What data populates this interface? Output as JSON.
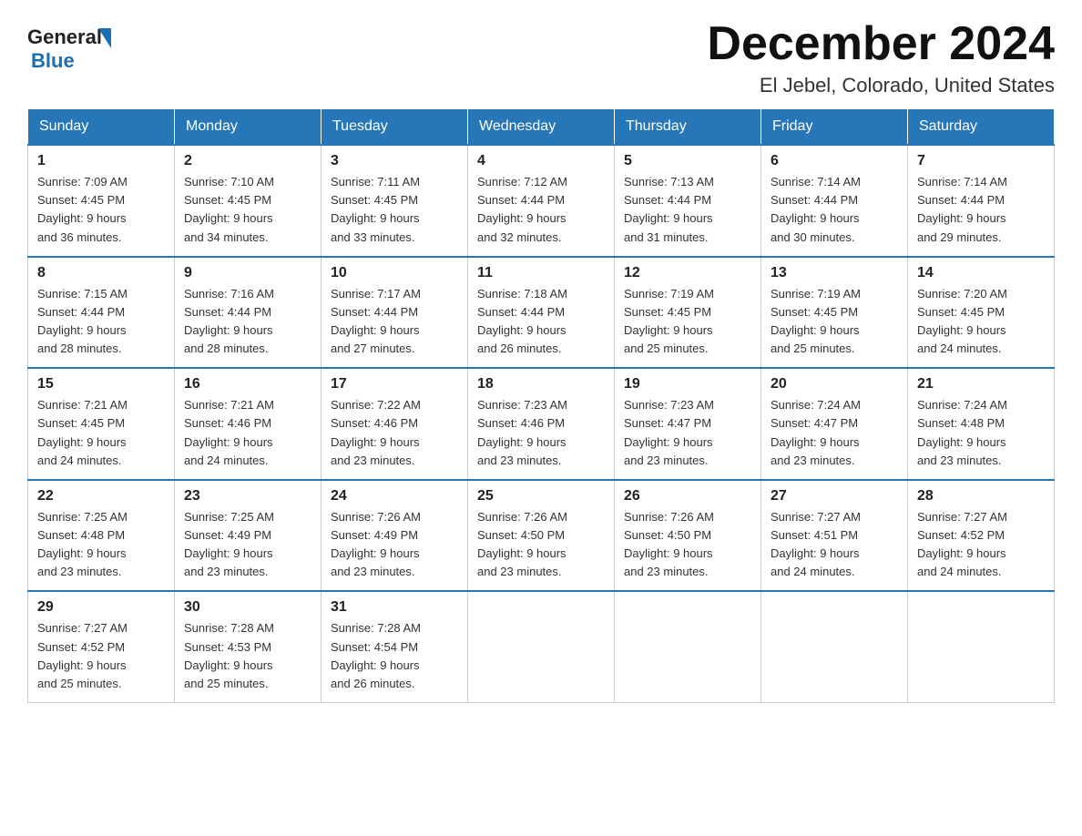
{
  "header": {
    "logo_general": "General",
    "logo_blue": "Blue",
    "title": "December 2024",
    "subtitle": "El Jebel, Colorado, United States"
  },
  "weekdays": [
    "Sunday",
    "Monday",
    "Tuesday",
    "Wednesday",
    "Thursday",
    "Friday",
    "Saturday"
  ],
  "weeks": [
    [
      {
        "num": "1",
        "sunrise": "7:09 AM",
        "sunset": "4:45 PM",
        "daylight": "9 hours and 36 minutes."
      },
      {
        "num": "2",
        "sunrise": "7:10 AM",
        "sunset": "4:45 PM",
        "daylight": "9 hours and 34 minutes."
      },
      {
        "num": "3",
        "sunrise": "7:11 AM",
        "sunset": "4:45 PM",
        "daylight": "9 hours and 33 minutes."
      },
      {
        "num": "4",
        "sunrise": "7:12 AM",
        "sunset": "4:44 PM",
        "daylight": "9 hours and 32 minutes."
      },
      {
        "num": "5",
        "sunrise": "7:13 AM",
        "sunset": "4:44 PM",
        "daylight": "9 hours and 31 minutes."
      },
      {
        "num": "6",
        "sunrise": "7:14 AM",
        "sunset": "4:44 PM",
        "daylight": "9 hours and 30 minutes."
      },
      {
        "num": "7",
        "sunrise": "7:14 AM",
        "sunset": "4:44 PM",
        "daylight": "9 hours and 29 minutes."
      }
    ],
    [
      {
        "num": "8",
        "sunrise": "7:15 AM",
        "sunset": "4:44 PM",
        "daylight": "9 hours and 28 minutes."
      },
      {
        "num": "9",
        "sunrise": "7:16 AM",
        "sunset": "4:44 PM",
        "daylight": "9 hours and 28 minutes."
      },
      {
        "num": "10",
        "sunrise": "7:17 AM",
        "sunset": "4:44 PM",
        "daylight": "9 hours and 27 minutes."
      },
      {
        "num": "11",
        "sunrise": "7:18 AM",
        "sunset": "4:44 PM",
        "daylight": "9 hours and 26 minutes."
      },
      {
        "num": "12",
        "sunrise": "7:19 AM",
        "sunset": "4:45 PM",
        "daylight": "9 hours and 25 minutes."
      },
      {
        "num": "13",
        "sunrise": "7:19 AM",
        "sunset": "4:45 PM",
        "daylight": "9 hours and 25 minutes."
      },
      {
        "num": "14",
        "sunrise": "7:20 AM",
        "sunset": "4:45 PM",
        "daylight": "9 hours and 24 minutes."
      }
    ],
    [
      {
        "num": "15",
        "sunrise": "7:21 AM",
        "sunset": "4:45 PM",
        "daylight": "9 hours and 24 minutes."
      },
      {
        "num": "16",
        "sunrise": "7:21 AM",
        "sunset": "4:46 PM",
        "daylight": "9 hours and 24 minutes."
      },
      {
        "num": "17",
        "sunrise": "7:22 AM",
        "sunset": "4:46 PM",
        "daylight": "9 hours and 23 minutes."
      },
      {
        "num": "18",
        "sunrise": "7:23 AM",
        "sunset": "4:46 PM",
        "daylight": "9 hours and 23 minutes."
      },
      {
        "num": "19",
        "sunrise": "7:23 AM",
        "sunset": "4:47 PM",
        "daylight": "9 hours and 23 minutes."
      },
      {
        "num": "20",
        "sunrise": "7:24 AM",
        "sunset": "4:47 PM",
        "daylight": "9 hours and 23 minutes."
      },
      {
        "num": "21",
        "sunrise": "7:24 AM",
        "sunset": "4:48 PM",
        "daylight": "9 hours and 23 minutes."
      }
    ],
    [
      {
        "num": "22",
        "sunrise": "7:25 AM",
        "sunset": "4:48 PM",
        "daylight": "9 hours and 23 minutes."
      },
      {
        "num": "23",
        "sunrise": "7:25 AM",
        "sunset": "4:49 PM",
        "daylight": "9 hours and 23 minutes."
      },
      {
        "num": "24",
        "sunrise": "7:26 AM",
        "sunset": "4:49 PM",
        "daylight": "9 hours and 23 minutes."
      },
      {
        "num": "25",
        "sunrise": "7:26 AM",
        "sunset": "4:50 PM",
        "daylight": "9 hours and 23 minutes."
      },
      {
        "num": "26",
        "sunrise": "7:26 AM",
        "sunset": "4:50 PM",
        "daylight": "9 hours and 23 minutes."
      },
      {
        "num": "27",
        "sunrise": "7:27 AM",
        "sunset": "4:51 PM",
        "daylight": "9 hours and 24 minutes."
      },
      {
        "num": "28",
        "sunrise": "7:27 AM",
        "sunset": "4:52 PM",
        "daylight": "9 hours and 24 minutes."
      }
    ],
    [
      {
        "num": "29",
        "sunrise": "7:27 AM",
        "sunset": "4:52 PM",
        "daylight": "9 hours and 25 minutes."
      },
      {
        "num": "30",
        "sunrise": "7:28 AM",
        "sunset": "4:53 PM",
        "daylight": "9 hours and 25 minutes."
      },
      {
        "num": "31",
        "sunrise": "7:28 AM",
        "sunset": "4:54 PM",
        "daylight": "9 hours and 26 minutes."
      },
      null,
      null,
      null,
      null
    ]
  ],
  "labels": {
    "sunrise": "Sunrise:",
    "sunset": "Sunset:",
    "daylight": "Daylight:"
  }
}
